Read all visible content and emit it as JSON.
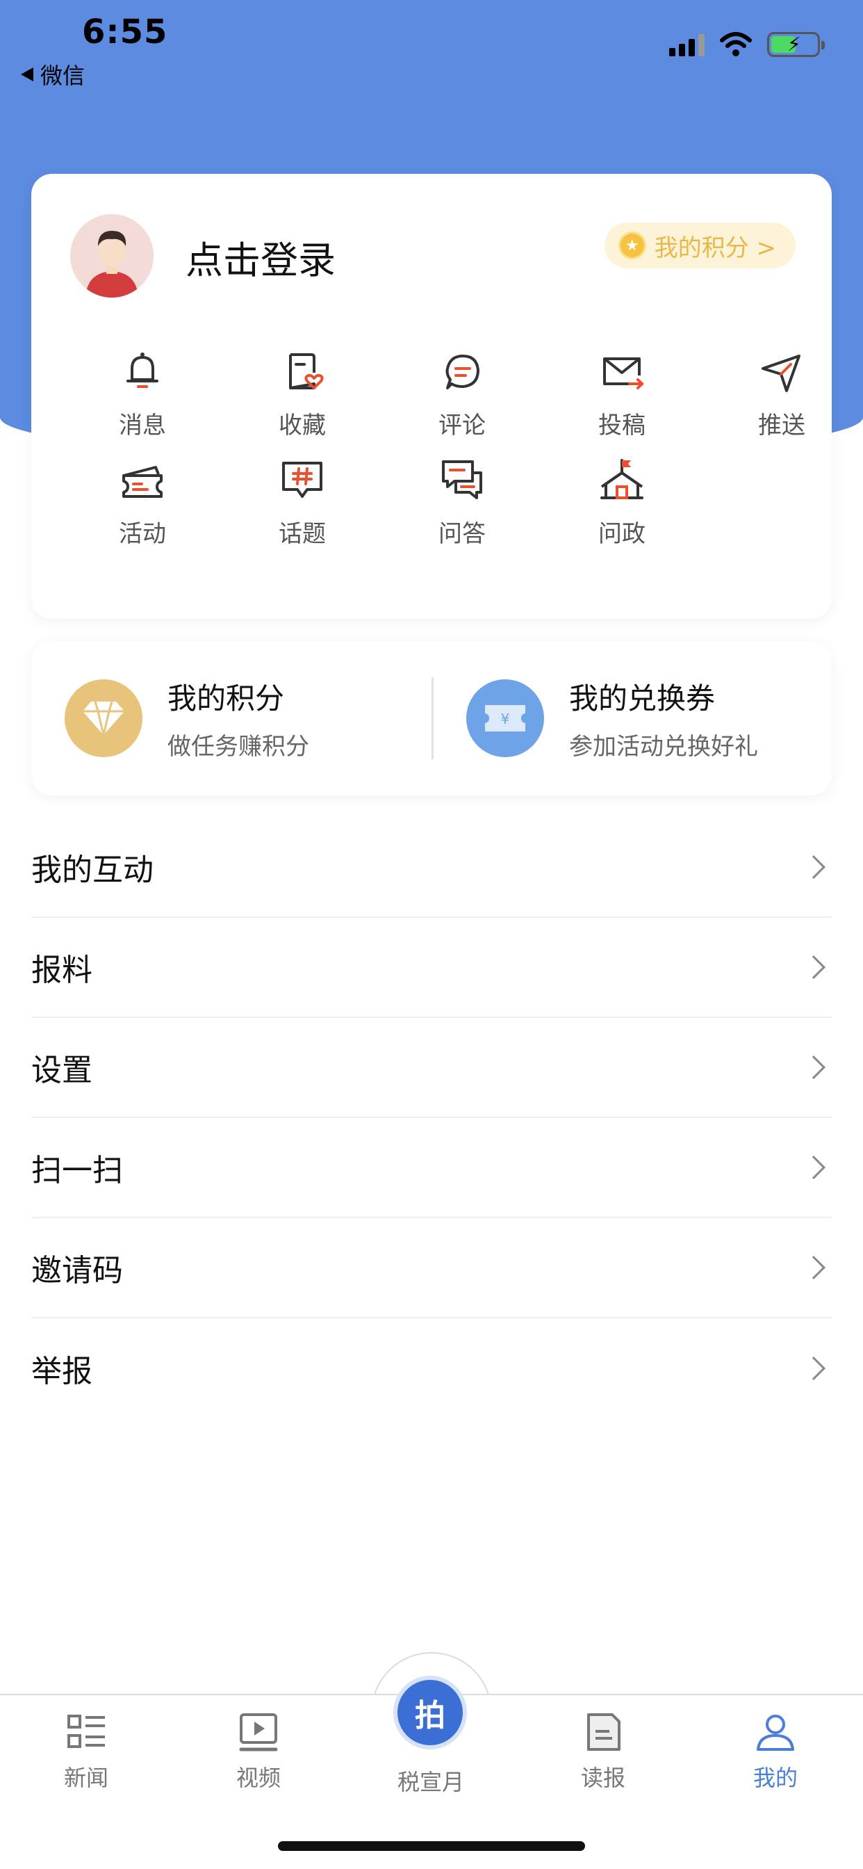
{
  "status_bar": {
    "time": "6:55",
    "back_app": "微信"
  },
  "profile": {
    "login_text": "点击登录",
    "points_pill": "我的积分 >"
  },
  "quick_actions": [
    {
      "label": "消息",
      "icon": "bell-icon"
    },
    {
      "label": "收藏",
      "icon": "favorite-doc-icon"
    },
    {
      "label": "评论",
      "icon": "comment-icon"
    },
    {
      "label": "投稿",
      "icon": "mail-submit-icon"
    },
    {
      "label": "推送",
      "icon": "send-arrow-icon"
    },
    {
      "label": "活动",
      "icon": "ticket-icon"
    },
    {
      "label": "话题",
      "icon": "hashtag-icon"
    },
    {
      "label": "问答",
      "icon": "qa-icon"
    },
    {
      "label": "问政",
      "icon": "government-icon"
    }
  ],
  "rewards": {
    "points": {
      "title": "我的积分",
      "subtitle": "做任务赚积分"
    },
    "coupons": {
      "title": "我的兑换券",
      "subtitle": "参加活动兑换好礼"
    }
  },
  "menu": [
    "我的互动",
    "报料",
    "设置",
    "扫一扫",
    "邀请码",
    "举报"
  ],
  "tabbar": {
    "news": "新闻",
    "video": "视频",
    "center_button": "拍",
    "center": "税宣月",
    "paper": "读报",
    "mine": "我的"
  },
  "colors": {
    "header_blue": "#5c8be0",
    "accent_red": "#e8502f",
    "active_tab": "#4a7fd8",
    "gold": "#e8c37a"
  }
}
